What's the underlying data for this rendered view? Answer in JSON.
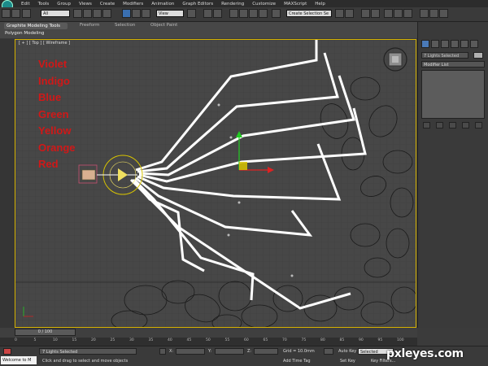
{
  "menu": [
    "Edit",
    "Tools",
    "Group",
    "Views",
    "Create",
    "Modifiers",
    "Animation",
    "Graph Editors",
    "Rendering",
    "Customize",
    "MAXScript",
    "Help"
  ],
  "toolbar": {
    "selection_filter": "All",
    "ref_coord": "View",
    "named_selection": "Create Selection Se"
  },
  "ribbon": {
    "tabs": [
      "Graphite Modeling Tools",
      "Freeform",
      "Selection",
      "Object Paint"
    ],
    "subpanel": "Polygon Modeling"
  },
  "viewport": {
    "label": "[ + ] [ Top ] [ Wireframe ]",
    "text_lines": [
      "Violet",
      "Indigo",
      "Blue",
      "Green",
      "Yellow",
      "Orange",
      "Red"
    ],
    "text_color": "#d01818"
  },
  "command_panel": {
    "object_name": "7 Lights Selected",
    "modifier_list": "Modifier List"
  },
  "timeline": {
    "slider": "0 / 100",
    "ticks": [
      "0",
      "5",
      "10",
      "15",
      "20",
      "25",
      "30",
      "35",
      "40",
      "45",
      "50",
      "55",
      "60",
      "65",
      "70",
      "75",
      "80",
      "85",
      "90",
      "95",
      "100"
    ]
  },
  "status": {
    "selection": "7 Lights Selected",
    "prompt": "Click and drag to select and move objects",
    "x_label": "X:",
    "y_label": "Y:",
    "z_label": "Z:",
    "grid": "Grid = 10.0mm",
    "add_time_tag": "Add Time Tag",
    "auto_key": "Auto Key",
    "selected": "Selected",
    "set_key": "Set Key",
    "key_filters": "Key Filters...",
    "welcome": "Welcome to M"
  },
  "watermark": "pxleyes.com"
}
